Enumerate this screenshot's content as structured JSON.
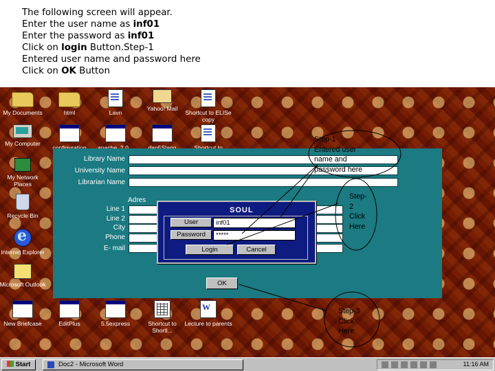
{
  "instructions": [
    {
      "pre": "The following screen will appear.",
      "bold": "",
      "post": ""
    },
    {
      "pre": "Enter the user name as ",
      "bold": "inf01",
      "post": ""
    },
    {
      "pre": "Enter the password as ",
      "bold": "inf01",
      "post": ""
    },
    {
      "pre": "Click on ",
      "bold": "login",
      "post": " Button.Step-1"
    },
    {
      "pre": "Entered user name and password here",
      "bold": "",
      "post": ""
    },
    {
      "pre": "Click on ",
      "bold": "OK",
      "post": " Button"
    }
  ],
  "desktop_icons": [
    {
      "label": "My Documents",
      "icon": "folder-icon"
    },
    {
      "label": "html",
      "icon": "folder-icon"
    },
    {
      "label": "Lavn",
      "icon": "document-icon"
    },
    {
      "label": "Yahoo! Mail",
      "icon": "mail-icon"
    },
    {
      "label": "Shortcut to ELISe copy",
      "icon": "shortcut-icon"
    },
    {
      "label": "My Computer",
      "icon": "computer-icon"
    },
    {
      "label": "configuration",
      "icon": "window-icon"
    },
    {
      "label": "apache_2.0...",
      "icon": "window-icon"
    },
    {
      "label": "dap5Slang",
      "icon": "window-icon"
    },
    {
      "label": "Shortcut to",
      "icon": "shortcut-icon"
    },
    {
      "label": "My Network Places",
      "icon": "network-icon"
    },
    {
      "label": "Recycle Bin",
      "icon": "recycle-bin-icon"
    },
    {
      "label": "Internet Explorer",
      "icon": "internet-explorer-icon"
    },
    {
      "label": "Microsoft Outlook",
      "icon": "outlook-icon"
    },
    {
      "label": "New Briefcase",
      "icon": "window-icon"
    },
    {
      "label": "EditPlus",
      "icon": "window-icon"
    },
    {
      "label": "5.5express",
      "icon": "window-icon"
    },
    {
      "label": "Shortcut to Shortl...",
      "icon": "grid-icon"
    },
    {
      "label": "Lecture to parents",
      "icon": "word-icon"
    }
  ],
  "app": {
    "fields": [
      "Library Name",
      "University Name",
      "Librarian Name"
    ],
    "address_label": "Adres",
    "address_fields": [
      "Line 1",
      "Line 2",
      "City",
      "Phone",
      "E- mail"
    ],
    "ok_button": "OK"
  },
  "dialog": {
    "title": "SOUL",
    "user_label": "User",
    "user_value": "inf01",
    "password_label": "Password",
    "password_value": "*****",
    "login_button": "Login",
    "cancel_button": "Cancel"
  },
  "callouts": {
    "step1": [
      "Step-1",
      "Entered user",
      "name and",
      "password here"
    ],
    "step2": [
      "Step-",
      "2",
      "Click",
      "Here"
    ],
    "step3": [
      "Step-3",
      "Click",
      "Here"
    ]
  },
  "taskbar": {
    "start": "Start",
    "task": "Doc2 - Microsoft Word",
    "clock": "11:16 AM"
  }
}
